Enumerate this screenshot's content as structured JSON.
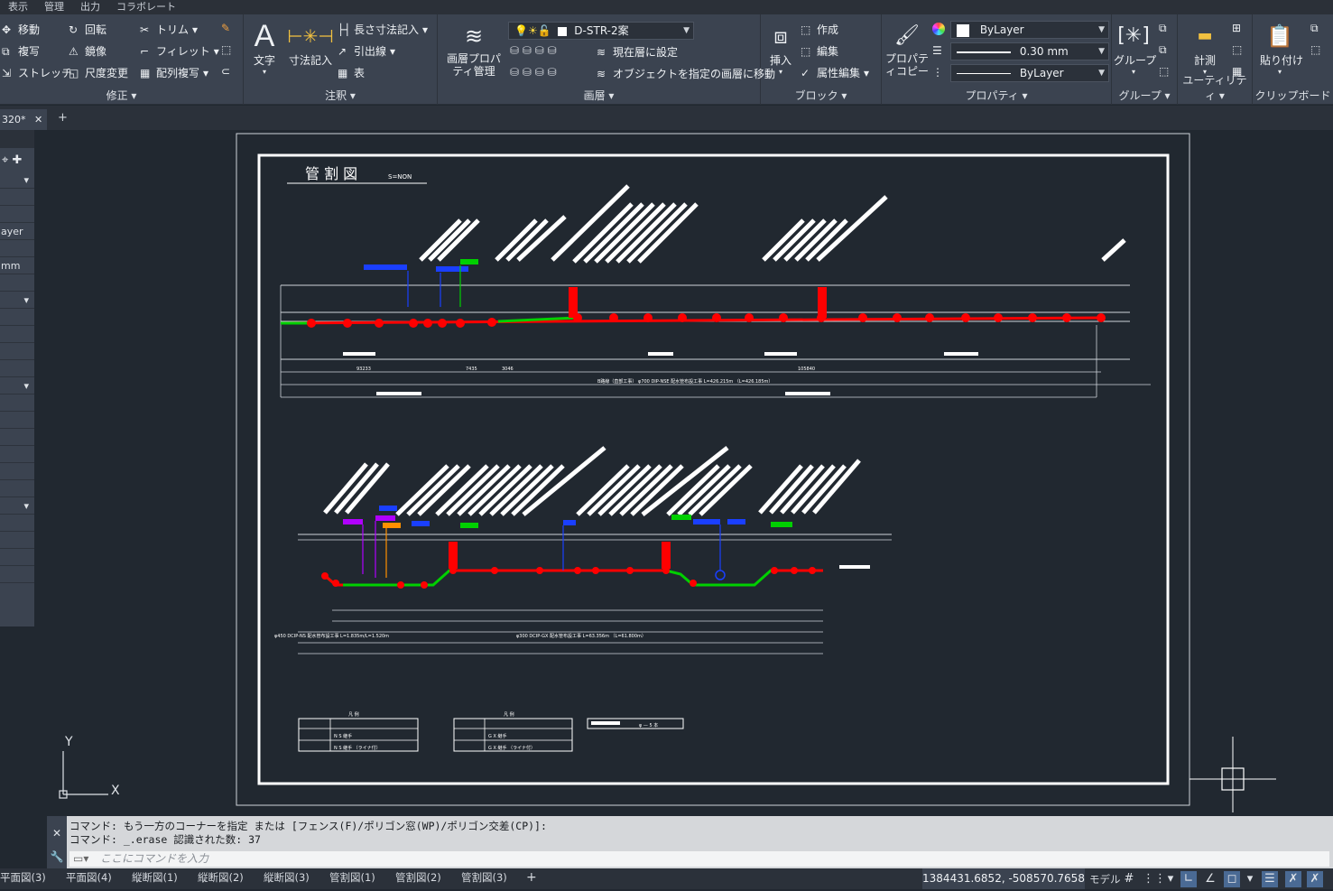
{
  "menubar": [
    "表示",
    "管理",
    "出力",
    "コラボレート"
  ],
  "ribbon": {
    "modify": {
      "title": "修正",
      "items": [
        "移動",
        "回転",
        "トリム",
        "複写",
        "鏡像",
        "フィレット",
        "ストレッチ",
        "尺度変更",
        "配列複写"
      ]
    },
    "annotation": {
      "title": "注釈",
      "text": "文字",
      "dimension": "寸法記入",
      "linear": "長さ寸法記入",
      "leader": "引出線",
      "table": "表"
    },
    "layers": {
      "title": "画層",
      "properties": "画層プロパティ管理",
      "current_layer": "D-STR-2案",
      "set_current": "現在層に設定",
      "move_to_layer": "オブジェクトを指定の画層に移動"
    },
    "block": {
      "title": "ブロック",
      "insert": "挿入",
      "create": "作成",
      "edit": "編集",
      "attr_edit": "属性編集"
    },
    "properties": {
      "title": "プロパティ",
      "match": "プロパティコピー",
      "color": "ByLayer",
      "lineweight": "0.30 mm",
      "linetype": "ByLayer"
    },
    "groups": {
      "title": "グループ",
      "group": "グループ"
    },
    "utilities": {
      "title": "ユーティリティ",
      "measure": "計測"
    },
    "clipboard": {
      "title": "クリップボード",
      "paste": "貼り付け"
    }
  },
  "doc_tab": {
    "name": "320*"
  },
  "left_palette": {
    "rows": [
      "",
      "",
      "",
      "",
      "ayer",
      "",
      "mm"
    ]
  },
  "drawing": {
    "title": "管 割 図",
    "scale": "S=NON",
    "upper_total": "105840",
    "upper_seg1": "93233",
    "upper_seg2": "7435",
    "upper_seg3": "3046",
    "upper_note": "B路線（直部工事） φ700 DIP-NSE 配水管布設工事 L=426.215m （L=426.185m）",
    "lower_note1": "φ450 DCIP-NS 配水管布設工事 L=1.835m/L=1.520m",
    "lower_note2": "φ300 DCIP-GX 配水管布設工事 L=63.356m （L=61.800m）",
    "legend1_title": "凡 例",
    "legend1_rows": [
      "N S 継手",
      "N S 継手 （ライナ付）"
    ],
    "legend2_title": "凡 例",
    "legend2_rows": [
      "G X 継手",
      "G X 継手 （ライナ付）"
    ],
    "legend3": "φ — 5 本"
  },
  "command": {
    "line1": "コマンド: もう一方のコーナーを指定 または [フェンス(F)/ポリゴン窓(WP)/ポリゴン交差(CP)]:",
    "line2": "コマンド: _.erase 認識された数: 37",
    "placeholder": "ここにコマンドを入力"
  },
  "layout_tabs": [
    "平面図(3)",
    "平面図(4)",
    "縦断図(1)",
    "縦断図(2)",
    "縦断図(3)",
    "管割図(1)",
    "管割図(2)",
    "管割図(3)"
  ],
  "status": {
    "coords": "1384431.6852, -508570.7658",
    "model": "モデル"
  },
  "ucs": {
    "x": "X",
    "y": "Y"
  },
  "colors": {
    "pipe": "#ff0000",
    "green": "#00d000",
    "blue": "#1a3fff",
    "purple": "#b000ff",
    "orange": "#ff9000"
  }
}
